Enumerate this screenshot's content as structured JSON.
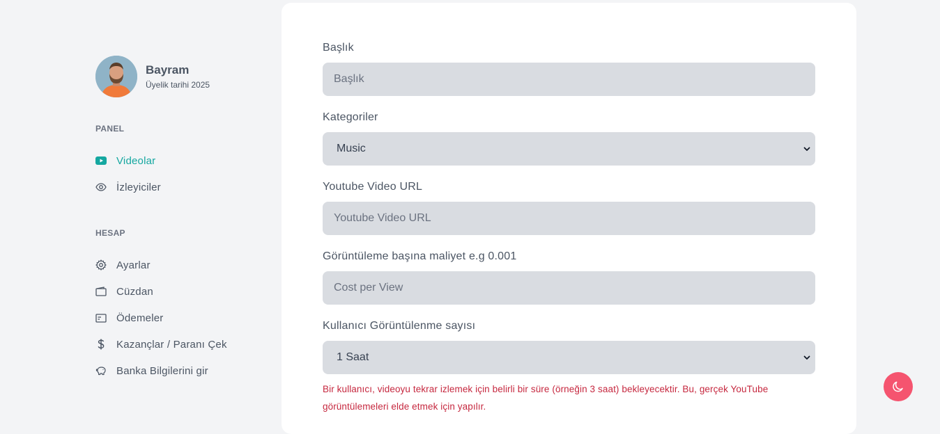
{
  "profile": {
    "name": "Bayram",
    "member_since": "Üyelik tarihi 2025"
  },
  "sidebar": {
    "panel_label": "PANEL",
    "panel_items": [
      {
        "label": "Videolar",
        "icon": "youtube-icon",
        "active": true
      },
      {
        "label": "İzleyiciler",
        "icon": "eye-icon",
        "active": false
      }
    ],
    "account_label": "HESAP",
    "account_items": [
      {
        "label": "Ayarlar",
        "icon": "gear-icon"
      },
      {
        "label": "Cüzdan",
        "icon": "wallet-icon"
      },
      {
        "label": "Ödemeler",
        "icon": "payments-icon"
      },
      {
        "label": "Kazançlar / Paranı Çek",
        "icon": "dollar-icon"
      },
      {
        "label": "Banka Bilgilerini gir",
        "icon": "piggy-bank-icon"
      }
    ]
  },
  "form": {
    "title_label": "Başlık",
    "title_placeholder": "Başlık",
    "categories_label": "Kategoriler",
    "categories_value": "Music",
    "url_label": "Youtube Video URL",
    "url_placeholder": "Youtube Video URL",
    "cpv_label": "Görüntüleme başına maliyet e.g 0.001",
    "cpv_placeholder": "Cost per View",
    "views_label": "Kullanıcı Görüntülenme sayısı",
    "views_value": "1 Saat",
    "help_text": "Bir kullanıcı, videoyu tekrar izlemek için belirli bir süre (örneğin 3 saat) bekleyecektir. Bu, gerçek YouTube görüntülemeleri elde etmek için yapılır."
  },
  "theme": {
    "accent": "#14a7a0",
    "error": "#c6283f",
    "fab": "#f5546f",
    "fab_icon": "moon-icon"
  }
}
